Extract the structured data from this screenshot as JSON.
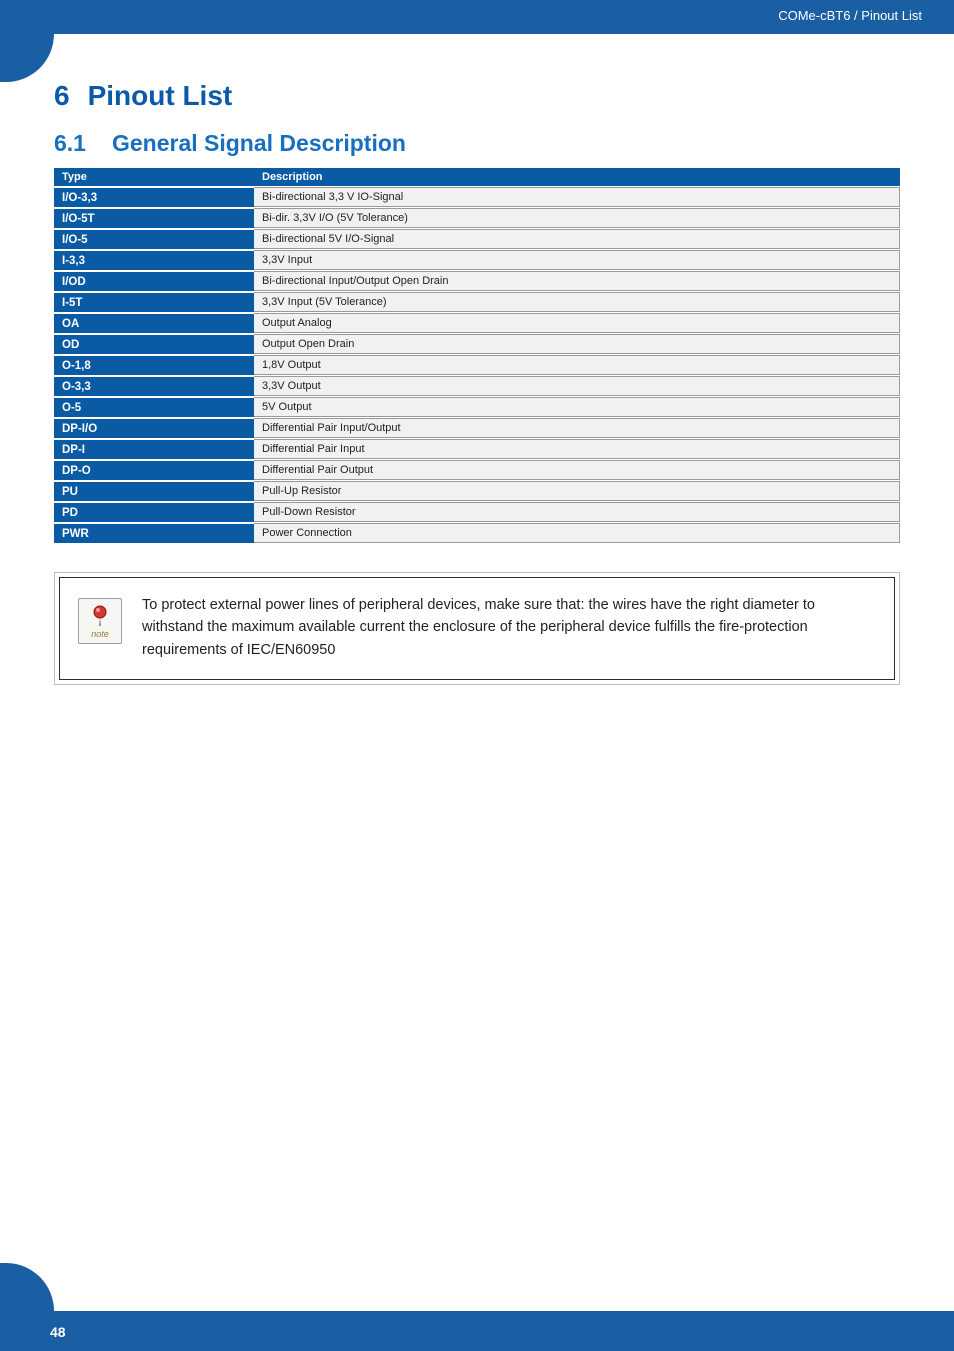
{
  "header": {
    "breadcrumb": "COMe-cBT6 / Pinout List"
  },
  "chapter": {
    "num": "6",
    "title": "Pinout List"
  },
  "section": {
    "num": "6.1",
    "title": "General Signal Description"
  },
  "table": {
    "headers": {
      "type": "Type",
      "desc": "Description"
    },
    "rows": [
      {
        "type": "I/O-3,3",
        "desc": "Bi-directional 3,3 V IO-Signal"
      },
      {
        "type": "I/O-5T",
        "desc": "Bi-dir. 3,3V I/O (5V Tolerance)"
      },
      {
        "type": "I/O-5",
        "desc": "Bi-directional 5V I/O-Signal"
      },
      {
        "type": "I-3,3",
        "desc": "3,3V Input"
      },
      {
        "type": "I/OD",
        "desc": "Bi-directional Input/Output Open Drain"
      },
      {
        "type": "I-5T",
        "desc": "3,3V Input (5V Tolerance)"
      },
      {
        "type": "OA",
        "desc": "Output Analog"
      },
      {
        "type": "OD",
        "desc": "Output Open Drain"
      },
      {
        "type": "O-1,8",
        "desc": "1,8V Output"
      },
      {
        "type": "O-3,3",
        "desc": "3,3V Output"
      },
      {
        "type": "O-5",
        "desc": "5V Output"
      },
      {
        "type": "DP-I/O",
        "desc": "Differential Pair Input/Output"
      },
      {
        "type": "DP-I",
        "desc": "Differential Pair Input"
      },
      {
        "type": "DP-O",
        "desc": "Differential Pair Output"
      },
      {
        "type": "PU",
        "desc": "Pull-Up Resistor"
      },
      {
        "type": "PD",
        "desc": "Pull-Down Resistor"
      },
      {
        "type": "PWR",
        "desc": "Power Connection"
      }
    ]
  },
  "note": {
    "label": "note",
    "text": "To protect external power lines of peripheral devices, make sure that: the wires have the right diameter to withstand the maximum available current the enclosure of the peripheral device fulfills the fire-protection requirements of IEC/EN60950"
  },
  "footer": {
    "page": "48"
  }
}
